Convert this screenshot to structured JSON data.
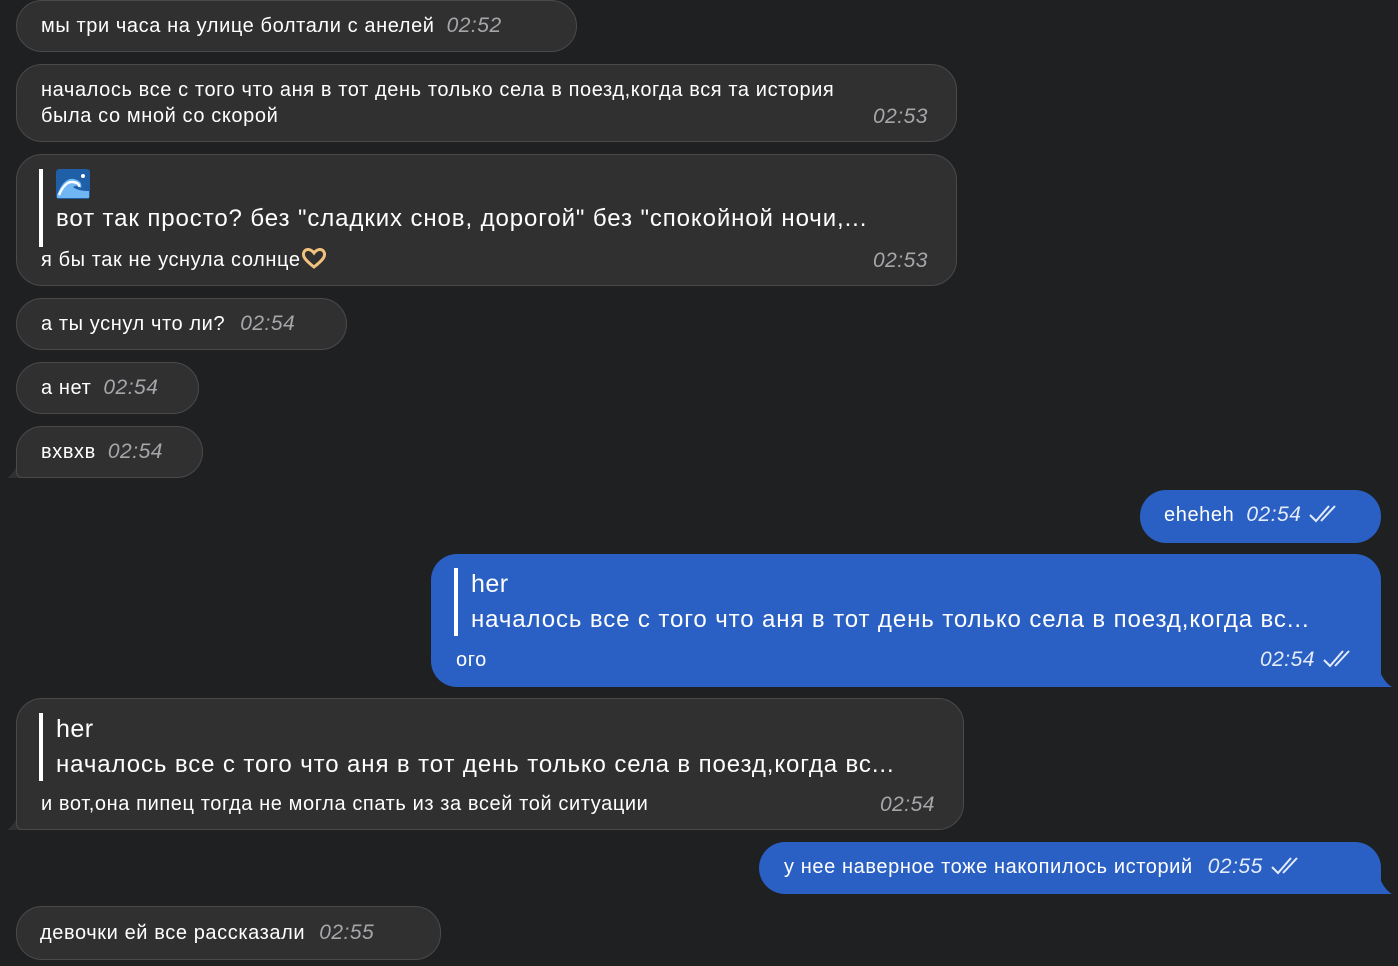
{
  "messages": [
    {
      "text": "мы три часа на улице болтали с анелей",
      "time": "02:52"
    },
    {
      "line1": "началось все с того что аня в тот день только села в поезд,когда вся та история",
      "line2": "была со мной со скорой",
      "time": "02:53"
    },
    {
      "quote_title_icon": "water-wave-emoji-icon",
      "quote_body": "вот так просто? без \"сладких снов, дорогой\" без \"спокойной ночи,...",
      "text": "я бы так не уснула солнце",
      "emoji": "heart-hands-emoji-icon",
      "time": "02:53"
    },
    {
      "text": "а ты уснул что ли?",
      "time": "02:54"
    },
    {
      "text": "а нет",
      "time": "02:54"
    },
    {
      "text": "вхвхв",
      "time": "02:54"
    },
    {
      "text": "eheheh",
      "time": "02:54",
      "status": "double-check-icon"
    },
    {
      "quote_title": "her",
      "quote_body": "началось все с того что аня в тот день только села в поезд,когда вс...",
      "text": "ого",
      "time": "02:54",
      "status": "double-check-icon"
    },
    {
      "quote_title": "her",
      "quote_body": "началось все с того что аня в тот день только села в поезд,когда вс...",
      "text": "и вот,она пипец тогда не могла спать из за всей той ситуации",
      "time": "02:54"
    },
    {
      "text": "у нее наверное тоже накопилось историй",
      "time": "02:55",
      "status": "double-check-icon"
    },
    {
      "text": "девочки ей все рассказали",
      "time": "02:55"
    }
  ],
  "colors": {
    "background": "#1f2022",
    "incoming_bubble": "#303031",
    "outgoing_bubble": "#2a5fc4"
  }
}
